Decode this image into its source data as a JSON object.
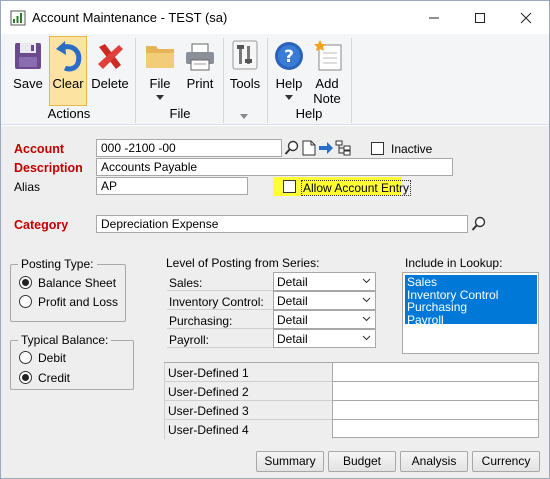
{
  "window": {
    "title": "Account Maintenance  -  TEST (sa)",
    "controls": {
      "minimize": "—",
      "maximize": "☐",
      "close": "✕"
    }
  },
  "ribbon": {
    "buttons": {
      "save": "Save",
      "clear": "Clear",
      "delete": "Delete",
      "file": "File",
      "print": "Print",
      "tools": "Tools",
      "help": "Help",
      "add_note_line1": "Add",
      "add_note_line2": "Note"
    },
    "groups": {
      "actions": "Actions",
      "file": "File",
      "help": "Help"
    }
  },
  "form": {
    "account": {
      "label": "Account",
      "value": "000 -2100 -00"
    },
    "inactive": {
      "label": "Inactive",
      "checked": false
    },
    "description": {
      "label": "Description",
      "value": "Accounts Payable"
    },
    "alias": {
      "label": "Alias",
      "value": "AP"
    },
    "allow_account_entry": {
      "label": "Allow Account Entry",
      "checked": false,
      "highlight": "#ffff33"
    },
    "category": {
      "label": "Category",
      "value": "Depreciation Expense"
    },
    "posting_type": {
      "title": "Posting Type:",
      "options": [
        "Balance Sheet",
        "Profit and Loss"
      ],
      "selected": "Balance Sheet"
    },
    "typical_balance": {
      "title": "Typical Balance:",
      "options": [
        "Debit",
        "Credit"
      ],
      "selected": "Credit"
    },
    "level_of_posting": {
      "title": "Level of Posting from Series:",
      "rows": [
        {
          "label": "Sales:",
          "value": "Detail"
        },
        {
          "label": "Inventory Control:",
          "value": "Detail"
        },
        {
          "label": "Purchasing:",
          "value": "Detail"
        },
        {
          "label": "Payroll:",
          "value": "Detail"
        }
      ]
    },
    "include_in_lookup": {
      "title": "Include in Lookup:",
      "items": [
        "Sales",
        "Inventory Control",
        "Purchasing",
        "Payroll"
      ],
      "selection_color": "#0078d7"
    },
    "user_defined": {
      "rows": [
        {
          "label": "User-Defined 1",
          "value": ""
        },
        {
          "label": "User-Defined 2",
          "value": ""
        },
        {
          "label": "User-Defined 3",
          "value": ""
        },
        {
          "label": "User-Defined 4",
          "value": ""
        }
      ]
    },
    "bottom_buttons": {
      "summary": "Summary",
      "budget": "Budget",
      "analysis": "Analysis",
      "currency": "Currency"
    }
  },
  "colors": {
    "required_label": "#c00000",
    "ribbon_bg": "#f4f5f7",
    "form_bg": "#eeeeee"
  }
}
